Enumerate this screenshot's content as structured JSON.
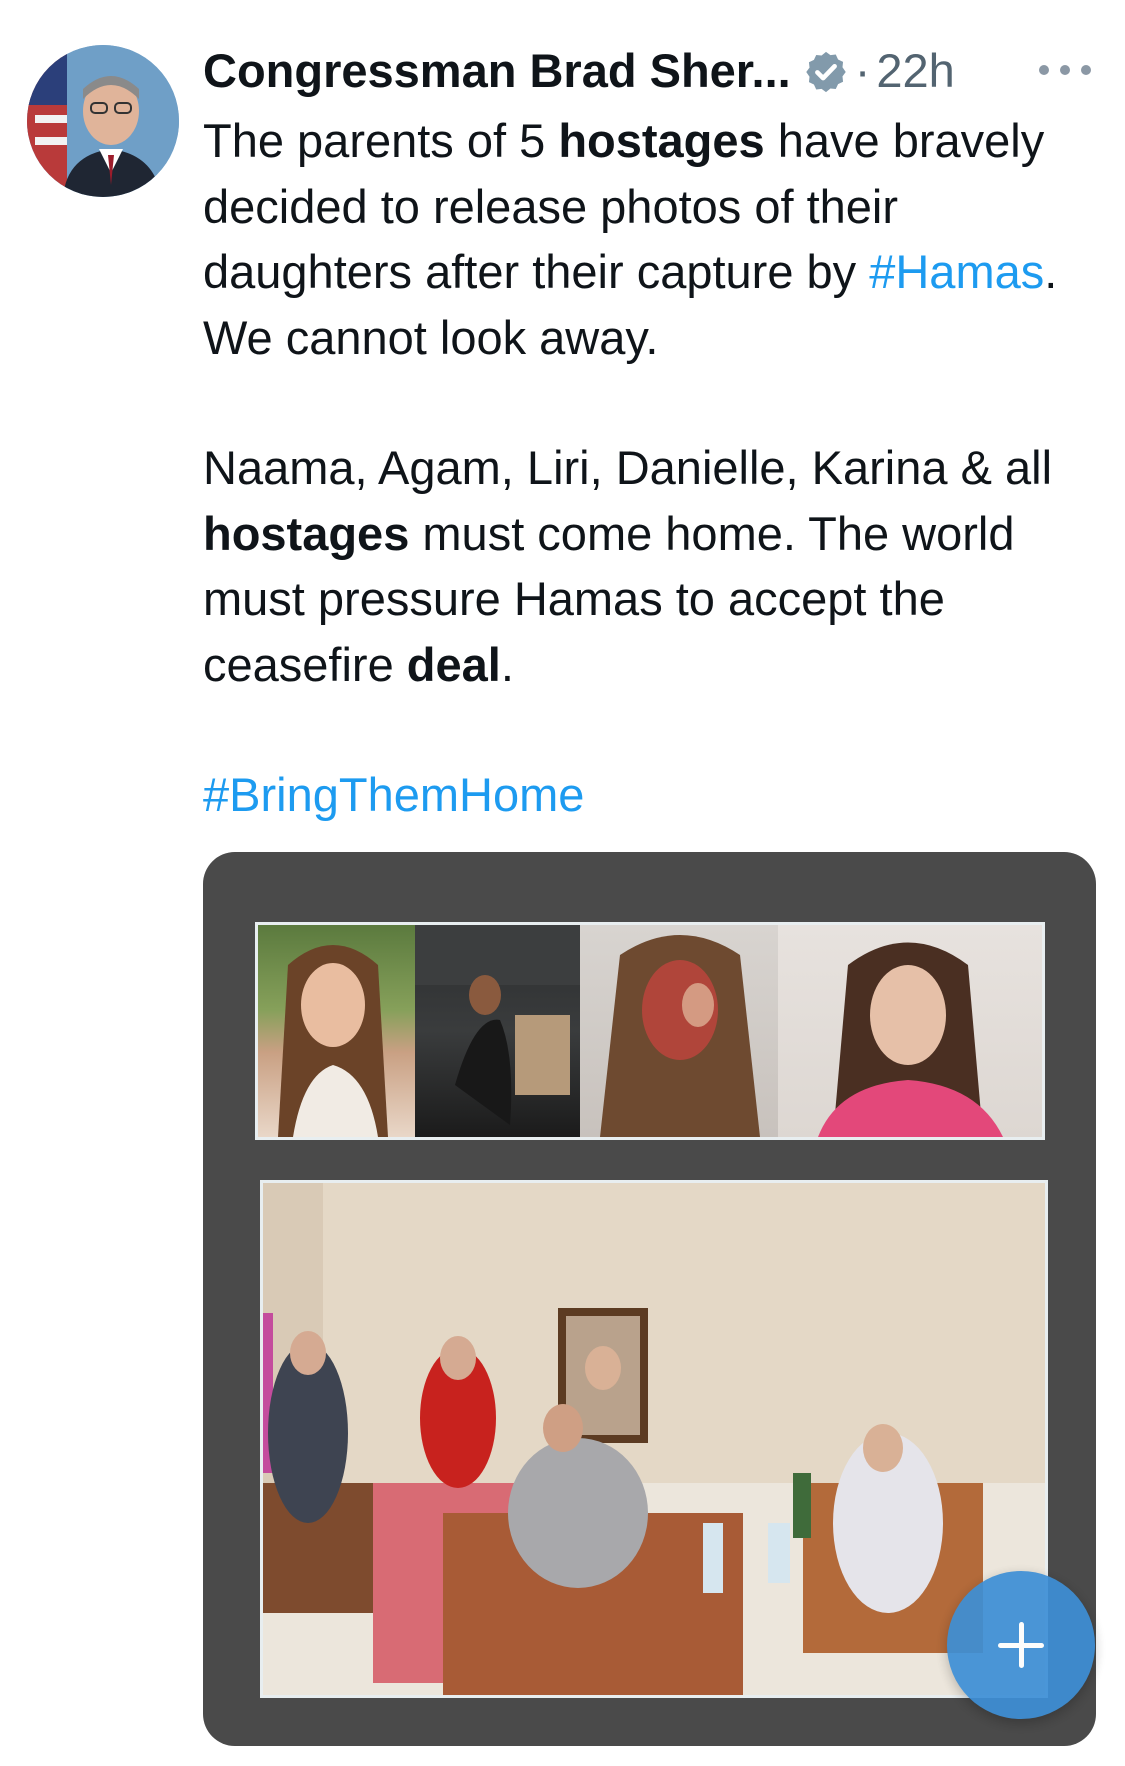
{
  "tweet": {
    "author": "Congressman Brad Sher...",
    "separator": "·",
    "time": "22h",
    "p1": {
      "a": "The parents of 5 ",
      "b": "hostages",
      "c": " have bravely decided to release photos of their daughters after their capture by ",
      "tag": "#Hamas",
      "d": ". We cannot look away."
    },
    "p2": {
      "a": "Naama, Agam, Liri, Danielle, Karina & all ",
      "b": "hostages",
      "c": " must come home. The world must pressure Hamas to accept the ceasefire ",
      "d": "deal",
      "e": "."
    },
    "p3": {
      "tag": "#BringThemHome"
    }
  },
  "icons": {
    "verified": "verified-badge-icon",
    "more": "more-options-icon",
    "compose": "plus-icon"
  },
  "colors": {
    "link": "#1d9bf0",
    "muted": "#536471",
    "card": "#4a4a4a",
    "fab": "#3d8fd6"
  }
}
